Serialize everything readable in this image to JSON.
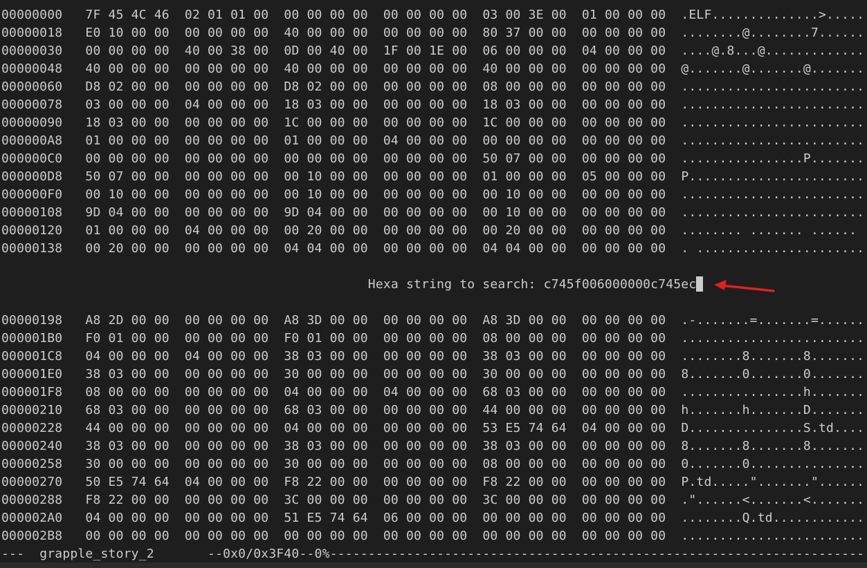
{
  "colors": {
    "background": "#1e1e1e",
    "text": "#cccccc",
    "annotation_arrow": "#e02020"
  },
  "top_rows": [
    {
      "offset": "00000000",
      "hex": [
        "7F 45 4C 46",
        "02 01 01 00",
        "00 00 00 00",
        "00 00 00 00",
        "03 00 3E 00",
        "01 00 00 00"
      ],
      "ascii": ".ELF..............>....."
    },
    {
      "offset": "00000018",
      "hex": [
        "E0 10 00 00",
        "00 00 00 00",
        "40 00 00 00",
        "00 00 00 00",
        "80 37 00 00",
        "00 00 00 00"
      ],
      "ascii": "........@........7......"
    },
    {
      "offset": "00000030",
      "hex": [
        "00 00 00 00",
        "40 00 38 00",
        "0D 00 40 00",
        "1F 00 1E 00",
        "06 00 00 00",
        "04 00 00 00"
      ],
      "ascii": "....@.8...@............."
    },
    {
      "offset": "00000048",
      "hex": [
        "40 00 00 00",
        "00 00 00 00",
        "40 00 00 00",
        "00 00 00 00",
        "40 00 00 00",
        "00 00 00 00"
      ],
      "ascii": "@.......@.......@......."
    },
    {
      "offset": "00000060",
      "hex": [
        "D8 02 00 00",
        "00 00 00 00",
        "D8 02 00 00",
        "00 00 00 00",
        "08 00 00 00",
        "00 00 00 00"
      ],
      "ascii": "........................"
    },
    {
      "offset": "00000078",
      "hex": [
        "03 00 00 00",
        "04 00 00 00",
        "18 03 00 00",
        "00 00 00 00",
        "18 03 00 00",
        "00 00 00 00"
      ],
      "ascii": "........................"
    },
    {
      "offset": "00000090",
      "hex": [
        "18 03 00 00",
        "00 00 00 00",
        "1C 00 00 00",
        "00 00 00 00",
        "1C 00 00 00",
        "00 00 00 00"
      ],
      "ascii": "........................"
    },
    {
      "offset": "000000A8",
      "hex": [
        "01 00 00 00",
        "00 00 00 00",
        "01 00 00 00",
        "04 00 00 00",
        "00 00 00 00",
        "00 00 00 00"
      ],
      "ascii": "........................"
    },
    {
      "offset": "000000C0",
      "hex": [
        "00 00 00 00",
        "00 00 00 00",
        "00 00 00 00",
        "00 00 00 00",
        "50 07 00 00",
        "00 00 00 00"
      ],
      "ascii": "................P......."
    },
    {
      "offset": "000000D8",
      "hex": [
        "50 07 00 00",
        "00 00 00 00",
        "00 10 00 00",
        "00 00 00 00",
        "01 00 00 00",
        "05 00 00 00"
      ],
      "ascii": "P......................."
    },
    {
      "offset": "000000F0",
      "hex": [
        "00 10 00 00",
        "00 00 00 00",
        "00 10 00 00",
        "00 00 00 00",
        "00 10 00 00",
        "00 00 00 00"
      ],
      "ascii": "........................"
    },
    {
      "offset": "00000108",
      "hex": [
        "9D 04 00 00",
        "00 00 00 00",
        "9D 04 00 00",
        "00 00 00 00",
        "00 10 00 00",
        "00 00 00 00"
      ],
      "ascii": "........................"
    },
    {
      "offset": "00000120",
      "hex": [
        "01 00 00 00",
        "04 00 00 00",
        "00 20 00 00",
        "00 00 00 00",
        "00 20 00 00",
        "00 00 00 00"
      ],
      "ascii": "........ ....... ......"
    },
    {
      "offset": "00000138",
      "hex": [
        "00 20 00 00",
        "00 00 00 00",
        "04 04 00 00",
        "00 00 00 00",
        "04 04 00 00",
        "00 00 00 00"
      ],
      "ascii": ". ......................"
    }
  ],
  "search": {
    "prompt": "Hexa string to search: ",
    "value": "c745f006000000c745ec"
  },
  "bottom_rows": [
    {
      "offset": "00000198",
      "hex": [
        "A8 2D 00 00",
        "00 00 00 00",
        "A8 3D 00 00",
        "00 00 00 00",
        "A8 3D 00 00",
        "00 00 00 00"
      ],
      "ascii": ".-.......=.......=......"
    },
    {
      "offset": "000001B0",
      "hex": [
        "F0 01 00 00",
        "00 00 00 00",
        "F0 01 00 00",
        "00 00 00 00",
        "08 00 00 00",
        "00 00 00 00"
      ],
      "ascii": "........................"
    },
    {
      "offset": "000001C8",
      "hex": [
        "04 00 00 00",
        "04 00 00 00",
        "38 03 00 00",
        "00 00 00 00",
        "38 03 00 00",
        "00 00 00 00"
      ],
      "ascii": "........8.......8......."
    },
    {
      "offset": "000001E0",
      "hex": [
        "38 03 00 00",
        "00 00 00 00",
        "30 00 00 00",
        "00 00 00 00",
        "30 00 00 00",
        "00 00 00 00"
      ],
      "ascii": "8.......0.......0......."
    },
    {
      "offset": "000001F8",
      "hex": [
        "08 00 00 00",
        "00 00 00 00",
        "04 00 00 00",
        "04 00 00 00",
        "68 03 00 00",
        "00 00 00 00"
      ],
      "ascii": "................h......."
    },
    {
      "offset": "00000210",
      "hex": [
        "68 03 00 00",
        "00 00 00 00",
        "68 03 00 00",
        "00 00 00 00",
        "44 00 00 00",
        "00 00 00 00"
      ],
      "ascii": "h.......h.......D......."
    },
    {
      "offset": "00000228",
      "hex": [
        "44 00 00 00",
        "00 00 00 00",
        "04 00 00 00",
        "00 00 00 00",
        "53 E5 74 64",
        "04 00 00 00"
      ],
      "ascii": "D...............S.td...."
    },
    {
      "offset": "00000240",
      "hex": [
        "38 03 00 00",
        "00 00 00 00",
        "38 03 00 00",
        "00 00 00 00",
        "38 03 00 00",
        "00 00 00 00"
      ],
      "ascii": "8.......8.......8......."
    },
    {
      "offset": "00000258",
      "hex": [
        "30 00 00 00",
        "00 00 00 00",
        "30 00 00 00",
        "00 00 00 00",
        "08 00 00 00",
        "00 00 00 00"
      ],
      "ascii": "0.......0..............."
    },
    {
      "offset": "00000270",
      "hex": [
        "50 E5 74 64",
        "04 00 00 00",
        "F8 22 00 00",
        "00 00 00 00",
        "F8 22 00 00",
        "00 00 00 00"
      ],
      "ascii": "P.td.....\".......\"......"
    },
    {
      "offset": "00000288",
      "hex": [
        "F8 22 00 00",
        "00 00 00 00",
        "3C 00 00 00",
        "00 00 00 00",
        "3C 00 00 00",
        "00 00 00 00"
      ],
      "ascii": ".\"......<.......<......."
    },
    {
      "offset": "000002A0",
      "hex": [
        "04 00 00 00",
        "00 00 00 00",
        "51 E5 74 64",
        "06 00 00 00",
        "00 00 00 00",
        "00 00 00 00"
      ],
      "ascii": "........Q.td............"
    },
    {
      "offset": "000002B8",
      "hex": [
        "00 00 00 00",
        "00 00 00 00",
        "00 00 00 00",
        "00 00 00 00",
        "00 00 00 00",
        "00 00 00 00"
      ],
      "ascii": "........................"
    }
  ],
  "status": {
    "prefix": "---",
    "filename": "grapple_story_2",
    "position": "--0x0/0x3F40--0%"
  }
}
